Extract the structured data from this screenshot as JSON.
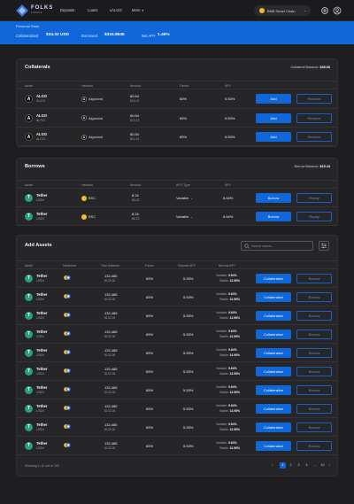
{
  "app": {
    "logo_name": "FOLKS",
    "logo_sub": "FINANCE",
    "nav": [
      "Deposits",
      "Loans",
      "xALGO",
      "More"
    ],
    "chain": "BNB Smart Chain"
  },
  "stats": {
    "title": "Personal Stats",
    "collateralized_label": "Collateralized",
    "collateralized_value": "$34.32 USD",
    "borrowed_label": "Borrowed",
    "borrowed_value": "$324.8645",
    "net_apy_label": "Net APY",
    "net_apy_value": "1.46%"
  },
  "collaterals": {
    "title": "Collaterals",
    "balance_label": "Collateral Balance:",
    "balance_value": "$38.66",
    "headers": [
      "Asset",
      "Network",
      "Amount",
      "Factor",
      "APY"
    ],
    "rows": [
      {
        "symbol": "ALGO",
        "name": "ALGO",
        "network": "Algorand",
        "amount": "60.54",
        "amount_usd": "$10.22",
        "factor": "65%",
        "apy": "5.53%",
        "primary": "Add",
        "secondary": "Remove"
      },
      {
        "symbol": "ALGO",
        "name": "ALGO",
        "network": "Algorand",
        "amount": "60.54",
        "amount_usd": "$10.22",
        "factor": "65%",
        "apy": "5.53%",
        "primary": "Add",
        "secondary": "Remove"
      },
      {
        "symbol": "ALGO",
        "name": "ALGO",
        "network": "Algorand",
        "amount": "60.54",
        "amount_usd": "$10.22",
        "factor": "65%",
        "apy": "5.53%",
        "primary": "Add",
        "secondary": "Remove"
      }
    ]
  },
  "borrows": {
    "title": "Borrows",
    "balance_label": "Borrow Balance:",
    "balance_value": "$15.44",
    "headers": [
      "Asset",
      "Network",
      "Amount",
      "APY Type",
      "APY"
    ],
    "rows": [
      {
        "symbol": "Tether",
        "name": "USDt",
        "network": "BSC",
        "amount": "8.24",
        "amount_usd": "$8.22",
        "apy_type": "Variable",
        "apy": "8.64%",
        "primary": "Borrow",
        "secondary": "Repay"
      },
      {
        "symbol": "Tether",
        "name": "USDt",
        "network": "BSC",
        "amount": "8.24",
        "amount_usd": "$8.22",
        "apy_type": "Variable",
        "apy": "8.64%",
        "primary": "Borrow",
        "secondary": "Repay"
      }
    ]
  },
  "add_assets": {
    "title": "Add Assets",
    "search_placeholder": "Search assets...",
    "headers": [
      "Asset",
      "Networks",
      "Your Balance",
      "Factor",
      "Deposit APY",
      "Borrow APY"
    ],
    "variable_label": "Variable:",
    "stable_label": "Stable:",
    "rows": [
      {
        "symbol": "Tether",
        "name": "USDt",
        "balance": "132,485",
        "balance_usd": "$132.08",
        "factor": "65%",
        "deposit_apy": "5.53%",
        "var_apy": "9.64%",
        "stable_apy": "13.95%",
        "primary": "Collateralize",
        "secondary": "Borrow"
      },
      {
        "symbol": "Tether",
        "name": "USDt",
        "balance": "132,485",
        "balance_usd": "$132.08",
        "factor": "65%",
        "deposit_apy": "5.53%",
        "var_apy": "9.64%",
        "stable_apy": "13.95%",
        "primary": "Collateralize",
        "secondary": "Borrow"
      },
      {
        "symbol": "Tether",
        "name": "USDt",
        "balance": "132,485",
        "balance_usd": "$132.08",
        "factor": "65%",
        "deposit_apy": "5.53%",
        "var_apy": "9.64%",
        "stable_apy": "13.95%",
        "primary": "Collateralize",
        "secondary": "Borrow"
      },
      {
        "symbol": "Tether",
        "name": "USDt",
        "balance": "132,485",
        "balance_usd": "$132.08",
        "factor": "65%",
        "deposit_apy": "5.53%",
        "var_apy": "9.64%",
        "stable_apy": "13.95%",
        "primary": "Collateralize",
        "secondary": "Borrow"
      },
      {
        "symbol": "Tether",
        "name": "USDt",
        "balance": "132,485",
        "balance_usd": "$132.08",
        "factor": "65%",
        "deposit_apy": "5.53%",
        "var_apy": "9.64%",
        "stable_apy": "13.95%",
        "primary": "Collateralize",
        "secondary": "Borrow"
      },
      {
        "symbol": "Tether",
        "name": "USDt",
        "balance": "132,485",
        "balance_usd": "$132.08",
        "factor": "65%",
        "deposit_apy": "5.53%",
        "var_apy": "9.64%",
        "stable_apy": "13.95%",
        "primary": "Collateralize",
        "secondary": "Borrow"
      },
      {
        "symbol": "Tether",
        "name": "USDt",
        "balance": "132,485",
        "balance_usd": "$132.08",
        "factor": "65%",
        "deposit_apy": "5.53%",
        "var_apy": "9.64%",
        "stable_apy": "13.95%",
        "primary": "Collateralize",
        "secondary": "Borrow"
      },
      {
        "symbol": "Tether",
        "name": "USDt",
        "balance": "132,485",
        "balance_usd": "$132.08",
        "factor": "65%",
        "deposit_apy": "5.53%",
        "var_apy": "9.64%",
        "stable_apy": "13.95%",
        "primary": "Collateralize",
        "secondary": "Borrow"
      },
      {
        "symbol": "Tether",
        "name": "USDt",
        "balance": "132,485",
        "balance_usd": "$132.08",
        "factor": "65%",
        "deposit_apy": "5.53%",
        "var_apy": "9.64%",
        "stable_apy": "13.95%",
        "primary": "Collateralize",
        "secondary": "Borrow"
      },
      {
        "symbol": "Tether",
        "name": "USDt",
        "balance": "132,485",
        "balance_usd": "$132.08",
        "factor": "65%",
        "deposit_apy": "5.53%",
        "var_apy": "9.64%",
        "stable_apy": "13.95%",
        "primary": "Collateralize",
        "secondary": "Borrow"
      }
    ],
    "showing": "Showing 1-10 out of 100",
    "pages": [
      "1",
      "2",
      "3",
      "4",
      "...",
      "10"
    ],
    "prev": "‹",
    "next": "›"
  },
  "colors": {
    "accent": "#0f67d9",
    "background": "#1e1e20",
    "card": "#262628",
    "tether": "#26a17b",
    "bnb": "#f3ba2f"
  },
  "icons": [
    "folks-logo-icon",
    "chevron-down-icon",
    "gear-icon",
    "user-icon",
    "search-icon",
    "filter-icon",
    "network-chip-icon"
  ]
}
